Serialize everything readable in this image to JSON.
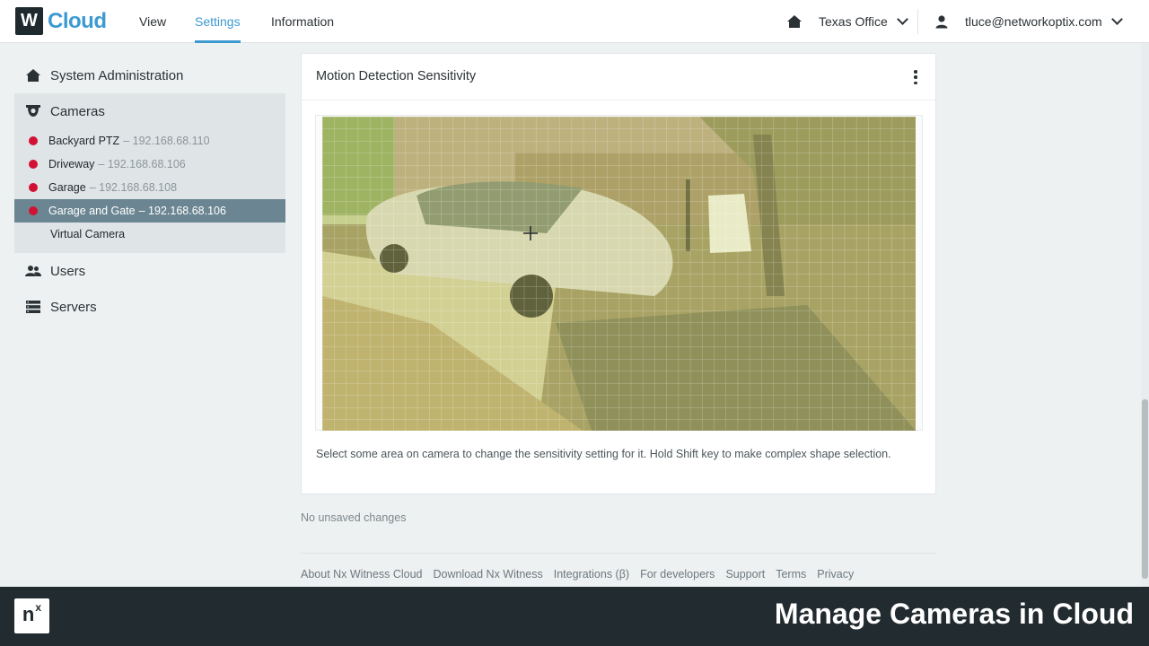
{
  "header": {
    "logo_mark": "W",
    "logo_text": "Cloud",
    "tabs": [
      {
        "label": "View"
      },
      {
        "label": "Settings",
        "active": true
      },
      {
        "label": "Information"
      }
    ],
    "system_name": "Texas Office",
    "user_email": "tluce@networkoptix.com"
  },
  "sidebar": {
    "system_admin": "System Administration",
    "cameras_label": "Cameras",
    "cameras": [
      {
        "name": "Backyard PTZ",
        "ip": "– 192.168.68.110",
        "status": "offline"
      },
      {
        "name": "Driveway",
        "ip": "– 192.168.68.106",
        "status": "offline"
      },
      {
        "name": "Garage",
        "ip": "– 192.168.68.108",
        "status": "offline"
      },
      {
        "name": "Garage and Gate",
        "ip": "– 192.168.68.106",
        "status": "offline",
        "selected": true
      }
    ],
    "virtual_camera": "Virtual Camera",
    "users": "Users",
    "servers": "Servers"
  },
  "card": {
    "title": "Motion Detection Sensitivity",
    "hint": "Select some area on camera to change the sensitivity setting for it. Hold Shift key to make complex shape selection."
  },
  "status": {
    "unsaved": "No unsaved changes"
  },
  "footer": {
    "links": [
      "About Nx Witness Cloud",
      "Download Nx Witness",
      "Integrations (β)",
      "For developers",
      "Support",
      "Terms",
      "Privacy"
    ]
  },
  "banner": {
    "logo": "n",
    "logo_sup": "x",
    "title": "Manage Cameras in Cloud"
  },
  "colors": {
    "accent": "#3d9ad1",
    "offline_dot": "#d21135",
    "selected_row": "#6b8692",
    "banner_bg": "#222b2f"
  }
}
